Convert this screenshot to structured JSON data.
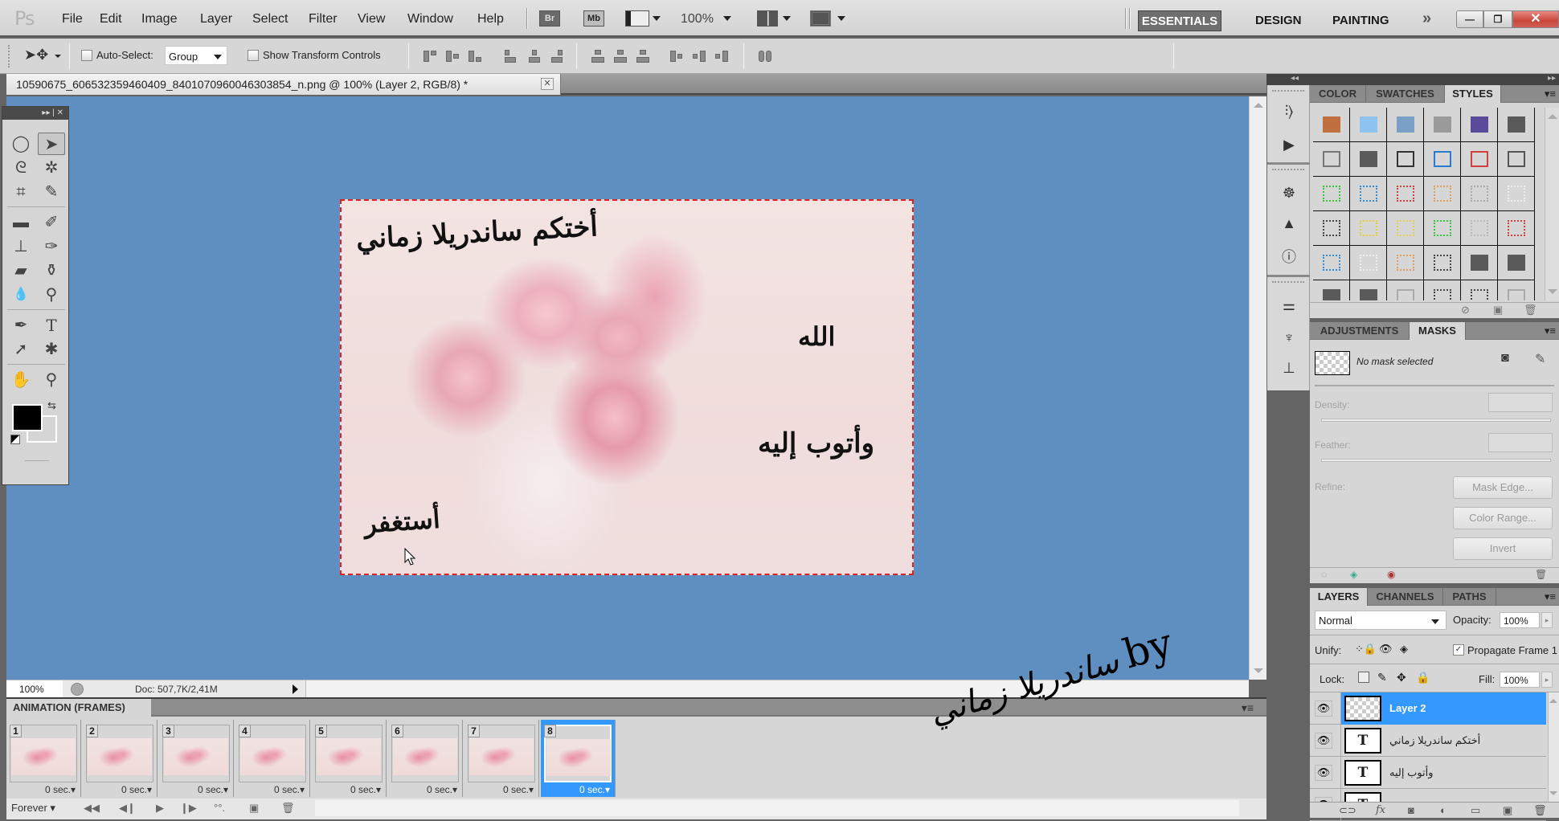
{
  "app": {
    "logo": "Ps",
    "menu": [
      "File",
      "Edit",
      "Image",
      "Layer",
      "Select",
      "Filter",
      "View",
      "Window",
      "Help"
    ],
    "app_buttons": {
      "bridge": "Br",
      "mini_bridge": "Mb"
    },
    "zoom_level": "100%",
    "workspaces": [
      "ESSENTIALS",
      "DESIGN",
      "PAINTING"
    ],
    "workspace_more": "»",
    "active_workspace": "ESSENTIALS",
    "window_controls": {
      "minimize": "—",
      "restore": "❐",
      "close": "✕"
    }
  },
  "options_bar": {
    "auto_select_label": "Auto-Select:",
    "auto_select_checked": false,
    "auto_select_value": "Group",
    "show_transform_label": "Show Transform Controls",
    "show_transform_checked": false
  },
  "document": {
    "tab_title": "10590675_606532359460409_8401070960046303854_n.png @ 100% (Layer 2, RGB/8) *",
    "close_label": "✕",
    "image_texts": {
      "top_left": "أختكم ساندريلا زماني",
      "right_top": "الله",
      "right_bottom": "وأتوب إليه",
      "bottom_left": "أستغفر"
    },
    "canvas_bg": "#5f8fc0"
  },
  "tools": {
    "header_icons": "▸▸ | ✕",
    "items": [
      {
        "name": "elliptical-marquee",
        "glyph": "◯"
      },
      {
        "name": "move",
        "glyph": "➤",
        "active": true
      },
      {
        "name": "lasso",
        "glyph": "ᘓ"
      },
      {
        "name": "magic-wand",
        "glyph": "✲"
      },
      {
        "name": "crop",
        "glyph": "⌗"
      },
      {
        "name": "eyedropper",
        "glyph": "✎"
      },
      {
        "name": "healing-brush",
        "glyph": "▬"
      },
      {
        "name": "brush",
        "glyph": "✐"
      },
      {
        "name": "clone-stamp",
        "glyph": "⊥"
      },
      {
        "name": "history-brush",
        "glyph": "✑"
      },
      {
        "name": "eraser",
        "glyph": "▰"
      },
      {
        "name": "paint-bucket",
        "glyph": "⚱"
      },
      {
        "name": "blur",
        "glyph": "💧"
      },
      {
        "name": "dodge",
        "glyph": "⚲"
      },
      {
        "name": "pen",
        "glyph": "✒"
      },
      {
        "name": "type",
        "glyph": "T"
      },
      {
        "name": "path-selection",
        "glyph": "➚"
      },
      {
        "name": "custom-shape",
        "glyph": "✱"
      },
      {
        "name": "hand",
        "glyph": "✋"
      },
      {
        "name": "zoom",
        "glyph": "⚲"
      }
    ],
    "foreground_color": "#000000",
    "background_color": "#d5d5d5"
  },
  "status_bar": {
    "zoom": "100%",
    "doc_info": "Doc: 507,7K/2,41M"
  },
  "animation": {
    "tab_label": "ANIMATION (FRAMES)",
    "frames": [
      {
        "number": "1",
        "delay": "0 sec."
      },
      {
        "number": "2",
        "delay": "0 sec."
      },
      {
        "number": "3",
        "delay": "0 sec."
      },
      {
        "number": "4",
        "delay": "0 sec."
      },
      {
        "number": "5",
        "delay": "0 sec."
      },
      {
        "number": "6",
        "delay": "0 sec."
      },
      {
        "number": "7",
        "delay": "0 sec."
      },
      {
        "number": "8",
        "delay": "0 sec.",
        "selected": true
      }
    ],
    "loop": "Forever",
    "controls": [
      "⏮",
      "◀|",
      "▶",
      "|▶",
      "tween",
      "new-frame",
      "delete-frame"
    ]
  },
  "watermark": {
    "arabic": "ساندريلا زماني",
    "latin": "by"
  },
  "styles_panel": {
    "tabs": [
      "COLOR",
      "SWATCHES",
      "STYLES"
    ],
    "active_tab": "STYLES",
    "swatches": [
      [
        "#c07040",
        "#8ec2ef",
        "#7aa0c8",
        "#9a9a9a",
        "#5a4a9a",
        "#5a5a5a"
      ],
      [
        "outline:#777",
        "#5a5a5a",
        "outline:#333",
        "outline:#2a7ad0",
        "outline:#d04040",
        "outline:#555"
      ],
      [
        "dash:#3bc23b",
        "dash:#3a8ad0",
        "dash:#d04040",
        "dash:#e0a060",
        "dash:#aaa",
        "dash:#eee"
      ],
      [
        "dash:#444",
        "dash:#e0d040",
        "dash:#e0d060",
        "dash:#40c040",
        "dash:#bbb",
        "dash:#d04040"
      ],
      [
        "dash:#3a8ad0",
        "dash:#eee",
        "dash:#e0a060",
        "dash:#444",
        "#5a5a5a",
        "#5a5a5a"
      ],
      [
        "#5a5a5a",
        "#5a5a5a",
        "outline:#aaa",
        "dash:#444",
        "dash:#444",
        "outline:#aaa"
      ]
    ]
  },
  "masks_panel": {
    "tabs": [
      "ADJUSTMENTS",
      "MASKS"
    ],
    "active_tab": "MASKS",
    "status": "No mask selected",
    "density_label": "Density:",
    "feather_label": "Feather:",
    "refine_label": "Refine:",
    "buttons": [
      "Mask Edge...",
      "Color Range...",
      "Invert"
    ]
  },
  "layers_panel": {
    "tabs": [
      "LAYERS",
      "CHANNELS",
      "PATHS"
    ],
    "active_tab": "LAYERS",
    "blend_mode": "Normal",
    "opacity_label": "Opacity:",
    "opacity": "100%",
    "unify_label": "Unify:",
    "propagate_label": "Propagate Frame 1",
    "propagate_checked": true,
    "lock_label": "Lock:",
    "fill_label": "Fill:",
    "fill": "100%",
    "layers": [
      {
        "name": "Layer 2",
        "type": "pixel",
        "visible": true,
        "selected": true
      },
      {
        "name": "أختكم ساندريلا زماني",
        "type": "text",
        "visible": true
      },
      {
        "name": "وأتوب إليه",
        "type": "text",
        "visible": true
      },
      {
        "name": "...",
        "type": "text",
        "visible": true
      }
    ]
  }
}
